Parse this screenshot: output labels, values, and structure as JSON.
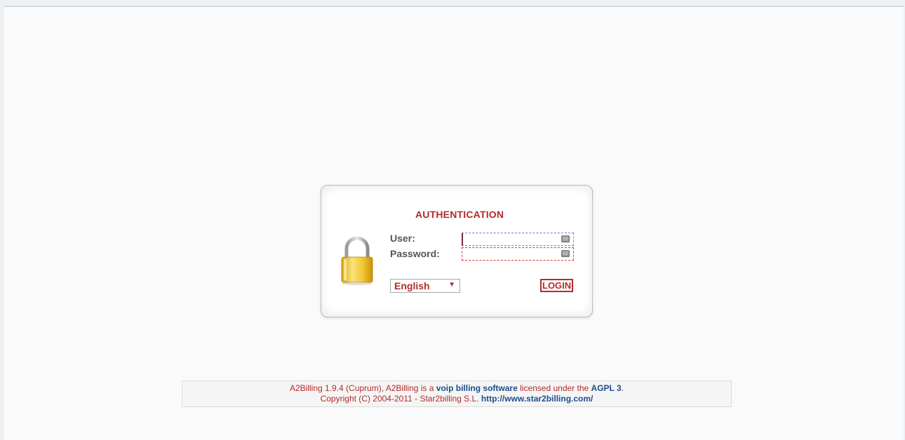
{
  "auth": {
    "title": "AUTHENTICATION",
    "user_label": "User:",
    "password_label": "Password:",
    "user_value": "",
    "password_value": "",
    "language": {
      "selected": "English"
    },
    "login_label": "LOGIN"
  },
  "icons": {
    "lock": "padlock-icon",
    "keyboard": "virtual-keyboard-icon",
    "dropdown": "chevron-down-icon"
  },
  "footer": {
    "line1_prefix": "A2Billing 1.9.4 (Cuprum), A2Billing is a ",
    "line1_link": "voip billing software",
    "line1_mid": " licensed under the ",
    "line1_license": "AGPL 3",
    "line1_suffix": ".",
    "line2_prefix": "Copyright (C) 2004-2011 - Star2billing S.L. ",
    "line2_link": "http://www.star2billing.com/"
  },
  "colors": {
    "accent_red": "#b32b2b",
    "link_blue": "#1b4f8a",
    "page_bg": "#fafafa"
  }
}
